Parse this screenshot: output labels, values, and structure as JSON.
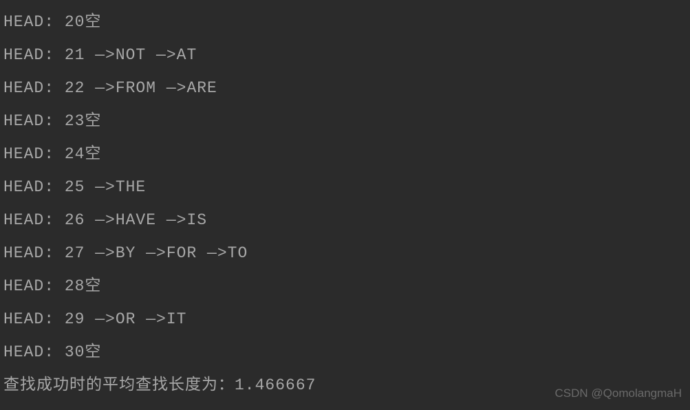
{
  "lines": [
    "HEAD: 20空",
    "HEAD: 21 —>NOT —>AT",
    "HEAD: 22 —>FROM —>ARE",
    "HEAD: 23空",
    "HEAD: 24空",
    "HEAD: 25 —>THE",
    "HEAD: 26 —>HAVE —>IS",
    "HEAD: 27 —>BY —>FOR —>TO",
    "HEAD: 28空",
    "HEAD: 29 —>OR —>IT",
    "HEAD: 30空",
    "查找成功时的平均查找长度为：1.466667"
  ],
  "watermark": "CSDN @QomolangmaH"
}
